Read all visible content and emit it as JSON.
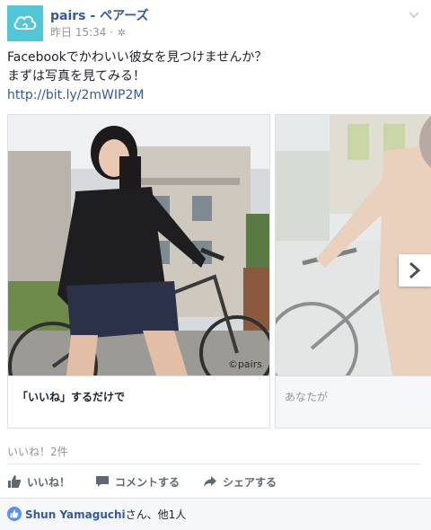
{
  "post": {
    "page_name": "pairs - ペアーズ",
    "timestamp": "昨日 15:34",
    "separator": " · ",
    "audience_icon": "gear-globe-icon",
    "text_line1": "Facebookでかわいい彼女を見つけませんか？",
    "text_line2": "まずは写真を見てみる！",
    "link": "http://bit.ly/2mWIP2M"
  },
  "carousel": {
    "cards": [
      {
        "caption": "「いいね」するだけで",
        "watermark": "©pairs"
      },
      {
        "caption": "あなたが"
      }
    ]
  },
  "stats": {
    "likes": "いいね！2件"
  },
  "actions": {
    "like": "いいね！",
    "comment": "コメントする",
    "share": "シェアする"
  },
  "footer": {
    "name": "Shun Yamaguchi",
    "rest": "さん、他1人"
  },
  "colors": {
    "brand": "#52c6d6",
    "link": "#365899",
    "like_blue": "#5890ff"
  }
}
